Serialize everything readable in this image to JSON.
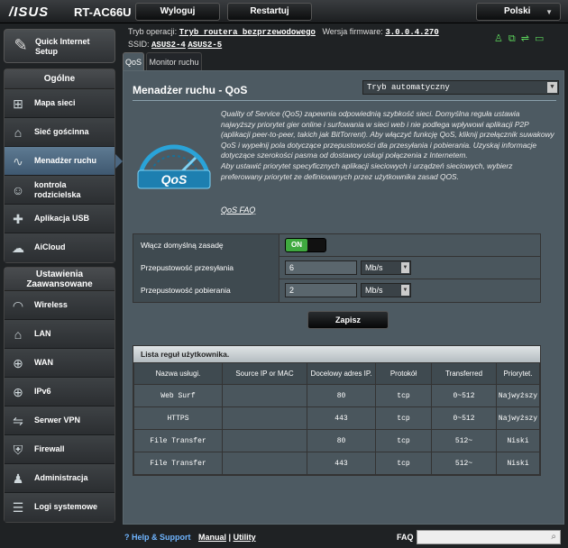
{
  "header": {
    "logo": "/ISUS",
    "model": "RT-AC66U",
    "logout_label": "Wyloguj",
    "restart_label": "Restartuj",
    "language": "Polski",
    "mode_label": "Tryb operacji:",
    "mode_value": "Tryb routera bezprzewodowego",
    "firmware_label": "Wersja firmware:",
    "firmware_value": "3.0.0.4.270",
    "ssid_label": "SSID:",
    "ssid_1": "ASUS2-4",
    "ssid_2": "ASUS2-5"
  },
  "sidebar": {
    "qis_label": "Quick Internet Setup",
    "general_title": "Ogólne",
    "general_items": [
      {
        "label": "Mapa sieci",
        "icon": "network-map-icon"
      },
      {
        "label": "Sieć gościnna",
        "icon": "guest-network-icon"
      },
      {
        "label": "Menadżer ruchu",
        "icon": "traffic-manager-icon"
      },
      {
        "label": "kontrola rodzicielska",
        "icon": "parental-control-icon"
      },
      {
        "label": "Aplikacja USB",
        "icon": "usb-app-icon"
      },
      {
        "label": "AiCloud",
        "icon": "aicloud-icon"
      }
    ],
    "advanced_title": "Ustawienia Zaawansowane",
    "advanced_items": [
      {
        "label": "Wireless",
        "icon": "wireless-icon"
      },
      {
        "label": "LAN",
        "icon": "lan-icon"
      },
      {
        "label": "WAN",
        "icon": "wan-icon"
      },
      {
        "label": "IPv6",
        "icon": "ipv6-icon"
      },
      {
        "label": "Serwer VPN",
        "icon": "vpn-icon"
      },
      {
        "label": "Firewall",
        "icon": "firewall-icon"
      },
      {
        "label": "Administracja",
        "icon": "admin-icon"
      },
      {
        "label": "Logi systemowe",
        "icon": "system-log-icon"
      }
    ]
  },
  "tabs": [
    "QoS",
    "Monitor ruchu"
  ],
  "main": {
    "title": "Menadżer ruchu - QoS",
    "mode_select": "Tryb automatyczny",
    "gauge_text": "QoS",
    "description": "Quality of Service (QoS) zapewnia odpowiednią szybkość sieci. Domyślna reguła ustawia najwyższy priorytet gier online i surfowania w sieci web i nie podlega wpływowi aplikacji P2P (aplikacji peer-to-peer, takich jak BitTorrent). Aby włączyć funkcję QoS, kliknij przełącznik suwakowy QoS i wypełnij pola dotyczące przepustowości dla przesyłania i pobierania. Uzyskaj informacje dotyczące szerokości pasma od dostawcy usługi połączenia z Internetem.",
    "description2": "Aby ustawić priorytet specyficznych aplikacji sieciowych i urządzeń sieciowych, wybierz preferowany priorytet ze definiowanych przez użytkownika zasad QOS.",
    "faq_link": "QoS FAQ",
    "form": {
      "enable_label": "Włącz domyślną zasadę",
      "enable_state": "ON",
      "upload_label": "Przepustowość przesyłania",
      "upload_value": "6",
      "upload_unit": "Mb/s",
      "download_label": "Przepustowość pobierania",
      "download_value": "2",
      "download_unit": "Mb/s"
    },
    "save_label": "Zapisz",
    "table": {
      "title": "Lista reguł użytkownika.",
      "columns": [
        "Nazwa usługi.",
        "Source IP or MAC",
        "Docelowy adres IP.",
        "Protokół",
        "Transferred",
        "Priorytet."
      ],
      "rows": [
        [
          "Web Surf",
          "",
          "80",
          "tcp",
          "0~512",
          "Najwyższy"
        ],
        [
          "HTTPS",
          "",
          "443",
          "tcp",
          "0~512",
          "Najwyższy"
        ],
        [
          "File Transfer",
          "",
          "80",
          "tcp",
          "512~",
          "Niski"
        ],
        [
          "File Transfer",
          "",
          "443",
          "tcp",
          "512~",
          "Niski"
        ]
      ]
    }
  },
  "footer": {
    "help": "Help & Support",
    "manual": "Manual",
    "separator": "|",
    "utility": "Utility",
    "faq": "FAQ"
  },
  "colors": {
    "accent": "#4b6680",
    "toggle_on": "#3fa93f",
    "link": "#6fb5ff"
  }
}
